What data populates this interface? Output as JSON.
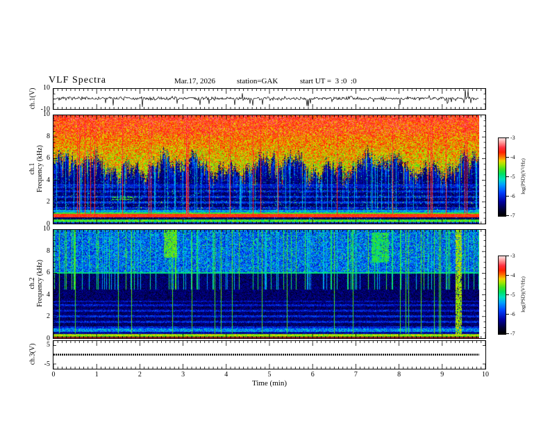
{
  "header": {
    "title": "VLF Spectra",
    "date": "Mar.17, 2026",
    "station": "station=GAK",
    "start_ut": "start UT =  3 :0  :0"
  },
  "axes": {
    "x": {
      "label": "Time (min)",
      "min": 0,
      "max": 10,
      "minor_step": 0.1,
      "tick_values": [
        0,
        1,
        2,
        3,
        4,
        5,
        6,
        7,
        8,
        9,
        10
      ],
      "tick_labels": [
        "0",
        "1",
        "2",
        "3",
        "4",
        "5",
        "6",
        "7",
        "8",
        "9",
        "10"
      ]
    }
  },
  "panels": [
    {
      "id": "ch1_wave",
      "ylabel": "ch.1(V)",
      "ymax": 10,
      "ymin": -10,
      "tick_values": [
        10,
        -10
      ],
      "tick_labels": [
        "10",
        "-10"
      ]
    },
    {
      "id": "ch1_spec",
      "ylabel1": "ch.1",
      "ylabel2": "Frequency (kHz)",
      "ymax": 10,
      "ymin": 0,
      "tick_values": [
        10,
        8,
        6,
        4,
        2,
        0
      ],
      "tick_labels": [
        "10",
        "8",
        "6",
        "4",
        "2",
        "0"
      ]
    },
    {
      "id": "ch2_spec",
      "ylabel1": "ch.2",
      "ylabel2": "Frequency (kHz)",
      "ymax": 10,
      "ymin": 0,
      "tick_values": [
        10,
        8,
        6,
        4,
        2,
        0
      ],
      "tick_labels": [
        "10",
        "8",
        "6",
        "4",
        "2",
        "0"
      ]
    },
    {
      "id": "ch3_wave",
      "ylabel": "ch.3(V)",
      "ymax": 7.4,
      "ymin": -7.6,
      "tick_values": [
        5,
        -5
      ],
      "tick_labels": [
        "5",
        "-5"
      ]
    }
  ],
  "colorbars": [
    {
      "label": "log(PSD)(V²/Hz)",
      "max": -3,
      "min": -7,
      "tick_labels": [
        "-3",
        "-4",
        "-5",
        "-6",
        "-7"
      ]
    },
    {
      "label": "log(PSD)(V²/Hz)",
      "max": -3,
      "min": -7,
      "tick_labels": [
        "-3",
        "-4",
        "-5",
        "-6",
        "-7"
      ]
    }
  ],
  "colormap_stops": [
    [
      0.0,
      "#000000"
    ],
    [
      0.07,
      "#000030"
    ],
    [
      0.18,
      "#0000a0"
    ],
    [
      0.3,
      "#0040ff"
    ],
    [
      0.4,
      "#00a0ff"
    ],
    [
      0.47,
      "#00e0c0"
    ],
    [
      0.54,
      "#00e060"
    ],
    [
      0.6,
      "#40e020"
    ],
    [
      0.66,
      "#a0e800"
    ],
    [
      0.71,
      "#f0d000"
    ],
    [
      0.76,
      "#ff7000"
    ],
    [
      0.82,
      "#ff2000"
    ],
    [
      0.88,
      "#ff3040"
    ],
    [
      0.94,
      "#ff9090"
    ],
    [
      1.0,
      "#ffe0e0"
    ]
  ],
  "chart_data": [
    {
      "type": "line",
      "panel": "ch.1(V)",
      "xlim": [
        0,
        10
      ],
      "ylim": [
        -10,
        10
      ],
      "x_units": "min",
      "data_end_min": 9.85,
      "description": "dense broadband noise ~+0.5 V mean, ±2.5 V fluctuation, intermittent impulsive spikes",
      "mean_v": 0.5,
      "noise_amp_v": 1.7,
      "spikes": [
        {
          "t_min": 2.05,
          "v": -8
        },
        {
          "t_min": 3.4,
          "v": -6
        },
        {
          "t_min": 4.62,
          "v": -6.5
        },
        {
          "t_min": 5.9,
          "v": -7.5
        },
        {
          "t_min": 8.02,
          "v": -6
        },
        {
          "t_min": 9.53,
          "v": 9.5
        },
        {
          "t_min": 9.6,
          "v": 8.5
        }
      ]
    },
    {
      "type": "heatmap",
      "panel": "ch.1 spectrogram",
      "xlim": [
        0,
        10
      ],
      "ylim": [
        0,
        10
      ],
      "zlabel": "log(PSD)(V²/Hz)",
      "zlim": [
        -7,
        -3
      ],
      "data_end_min": 9.85,
      "features": [
        {
          "freq_khz": [
            6,
            10
          ],
          "psd": "-4.5 to -3.5",
          "appearance": "bright green/yellow VLF hiss with red sferic streaks, ragged lower edge spiking down to ~4 kHz"
        },
        {
          "freq_khz": [
            1.8,
            6
          ],
          "psd": "-7 to -6.2",
          "appearance": "dark background, blue speckle, vertical sferic streak tails"
        },
        {
          "freq_khz": [
            1.05,
            1.3
          ],
          "psd": "-5.8",
          "appearance": "blue/cyan speckle band"
        },
        {
          "freq_khz": [
            0.93,
            1.05
          ],
          "psd": "-4.9",
          "appearance": "thin green line"
        },
        {
          "freq_khz": [
            0.6,
            0.93
          ],
          "psd": "-3.8",
          "appearance": "intense red/orange hum band"
        },
        {
          "freq_khz": [
            0.4,
            0.6
          ],
          "psd": "-6.8",
          "appearance": "dark gap with sparse speckle"
        },
        {
          "freq_khz": [
            0.13,
            0.4
          ],
          "psd": "-5.0",
          "appearance": "green/cyan band"
        },
        {
          "freq_khz": [
            0,
            0.13
          ],
          "psd": "-6.3",
          "appearance": "dark blue edge band"
        }
      ],
      "render": {
        "seed": 12345,
        "boundary_base": 4.9,
        "boundary_amp": 1.3,
        "top_t": [
          0.6,
          0.22
        ],
        "red_speck_prob": 0.1,
        "red_t": 0.88,
        "toprow_f": 9.55,
        "toprow_prob": 0.3,
        "dark_t": [
          0.04,
          0.18
        ],
        "cyan_prob": 0.035,
        "cyan_t": 0.45,
        "hbands": [
          [
            1.35,
            1.55,
            0.12
          ],
          [
            1.9,
            2.1,
            0.14
          ],
          [
            2.4,
            2.6,
            0.12
          ],
          [
            2.9,
            3.1,
            0.1
          ],
          [
            3.3,
            3.7,
            0.08
          ]
        ],
        "bands": [
          [
            1.05,
            1.3,
            0.28,
            0.24
          ],
          [
            0.93,
            1.05,
            0.55,
            0.1
          ],
          [
            0.6,
            0.93,
            0.76,
            0.14
          ],
          [
            0.4,
            0.6,
            0.04,
            0.14
          ],
          [
            0.13,
            0.4,
            0.5,
            0.18
          ],
          [
            0,
            0.13,
            0.12,
            0.23
          ]
        ],
        "streak_red_prob": 0.045,
        "streak_cyan_prob": 0.1,
        "dashes": [
          {
            "x": [
              1.35,
              1.9
            ],
            "f": [
              2.2,
              2.5
            ],
            "t": 0.55
          }
        ]
      }
    },
    {
      "type": "heatmap",
      "panel": "ch.2 spectrogram",
      "xlim": [
        0,
        10
      ],
      "ylim": [
        0,
        10
      ],
      "zlabel": "log(PSD)(V²/Hz)",
      "zlim": [
        -7,
        -3
      ],
      "data_end_min": 9.85,
      "features": [
        {
          "freq_khz": [
            6.2,
            10
          ],
          "psd": "-6 to -5",
          "appearance": "blue/cyan speckle with dense vertical cyan streaks and a few green patches"
        },
        {
          "freq_khz": [
            3.5,
            6.2
          ],
          "psd": "-7 to -6.5",
          "appearance": "very dark, sparse blue speckle"
        },
        {
          "freq_khz": [
            0.95,
            3.5
          ],
          "psd": "-6.5",
          "appearance": "alternating faint horizontal blue speckle bands (~0.5 kHz spacing)"
        },
        {
          "freq_khz": [
            0.6,
            0.95
          ],
          "psd": "-5.8",
          "appearance": "brighter blue/cyan band"
        },
        {
          "freq_khz": [
            0.18,
            0.42
          ],
          "psd": "-4.7",
          "appearance": "bright green/yellow hum band"
        },
        {
          "freq_khz": [
            0.03,
            0.1
          ],
          "psd": "-4.0",
          "appearance": "thin dark-red line"
        }
      ],
      "render": {
        "seed": 987,
        "top_f": 6.15,
        "top_t": [
          0.2,
          0.25
        ],
        "top_cyan_prob": 0.12,
        "top_cyan_t": 0.47,
        "line_f": [
          6.0,
          6.15
        ],
        "line_t": 0.48,
        "dark_t": [
          0.05,
          0.15
        ],
        "hbands": [
          [
            0.95,
            1.15,
            0.13
          ],
          [
            1.45,
            1.65,
            0.12
          ],
          [
            1.95,
            2.15,
            0.13
          ],
          [
            2.45,
            2.65,
            0.11
          ],
          [
            2.95,
            3.15,
            0.1
          ],
          [
            3.35,
            3.5,
            0.08
          ]
        ],
        "bands": [
          [
            0.6,
            0.95,
            0.25,
            0.25
          ],
          [
            0.42,
            0.6,
            0.1,
            0.15
          ],
          [
            0.18,
            0.42,
            0.58,
            0.16
          ],
          [
            0.1,
            0.18,
            0.02,
            0.08
          ],
          [
            0.03,
            0.1,
            0.8,
            0.08
          ],
          [
            0,
            0.03,
            0.05,
            0.05
          ]
        ],
        "streak_green_prob": 0.035,
        "streak_cyan_prob": 0.16,
        "blobs": [
          {
            "x": [
              2.55,
              2.85
            ],
            "f": [
              7.5,
              10
            ],
            "t": 0.55
          },
          {
            "x": [
              7.35,
              7.75
            ],
            "f": [
              7,
              9.8
            ],
            "t": 0.5
          },
          {
            "x": [
              9.3,
              9.45
            ],
            "f": [
              0.4,
              10
            ],
            "t": 0.6
          }
        ]
      }
    },
    {
      "type": "line",
      "panel": "ch.3(V)",
      "xlim": [
        0,
        10
      ],
      "ylim": [
        -7.6,
        7.4
      ],
      "x_units": "min",
      "data_end_min": 9.85,
      "value_v": 0,
      "description": "flat thick dotted trace at 0 V (channel off / no signal)"
    }
  ]
}
